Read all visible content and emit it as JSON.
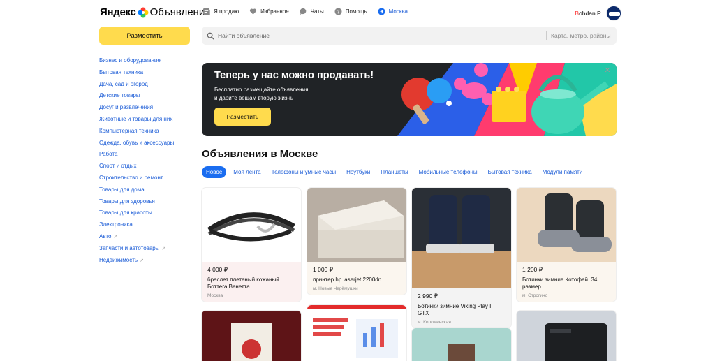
{
  "header": {
    "logo_brand": "Яндекс",
    "logo_service": "Объявления",
    "nav": [
      {
        "label": "Я продаю",
        "icon": "tag-icon"
      },
      {
        "label": "Избранное",
        "icon": "heart-icon"
      },
      {
        "label": "Чаты",
        "icon": "chat-icon"
      },
      {
        "label": "Помощь",
        "icon": "help-icon"
      },
      {
        "label": "Москва",
        "icon": "location-icon"
      }
    ],
    "user_first_letter": "B",
    "user_rest": "ohdan P."
  },
  "left": {
    "post_button": "Разместить",
    "categories": [
      "Бизнес и оборудование",
      "Бытовая техника",
      "Дача, сад и огород",
      "Детские товары",
      "Досуг и развлечения",
      "Животные и товары для них",
      "Компьютерная техника",
      "Одежда, обувь и аксессуары",
      "Работа",
      "Спорт и отдых",
      "Строительство и ремонт",
      "Товары для дома",
      "Товары для здоровья",
      "Товары для красоты",
      "Электроника",
      "Авто",
      "Запчасти и автотовары",
      "Недвижимость"
    ]
  },
  "search": {
    "placeholder": "Найти объявление",
    "location_placeholder": "Карта, метро, районы"
  },
  "banner": {
    "title": "Теперь у нас можно продавать!",
    "subtitle_line1": "Бесплатно размещайте объявления",
    "subtitle_line2": "и дарите вещам вторую жизнь",
    "button": "Разместить",
    "close_icon": "close-icon"
  },
  "section": {
    "title": "Объявления в Москве",
    "tabs": [
      "Новое",
      "Моя лента",
      "Телефоны и умные часы",
      "Ноутбуки",
      "Планшеты",
      "Мобильные телефоны",
      "Бытовая техника",
      "Модули памяти"
    ]
  },
  "listings": [
    {
      "price": "4 000 ₽",
      "title": "браслет плетеный кожаный Боттега Венетта",
      "location": "Москва"
    },
    {
      "price": "1 000 ₽",
      "title": "принтер hp laserjet 2200dn",
      "location": "м. Новые Черёмушки"
    },
    {
      "price": "2 990 ₽",
      "title": "Ботинки зимние Viking Play II GTX",
      "location": "м. Коломенская"
    },
    {
      "price": "1 200 ₽",
      "title": "Ботинки зимние Котофей. 34 размер",
      "location": "м. Строгино"
    }
  ],
  "colors": {
    "accent_yellow": "#ffdb4d",
    "link_blue": "#1a5bd6",
    "tab_active": "#1a6df0",
    "banner_bg": "#202326"
  }
}
